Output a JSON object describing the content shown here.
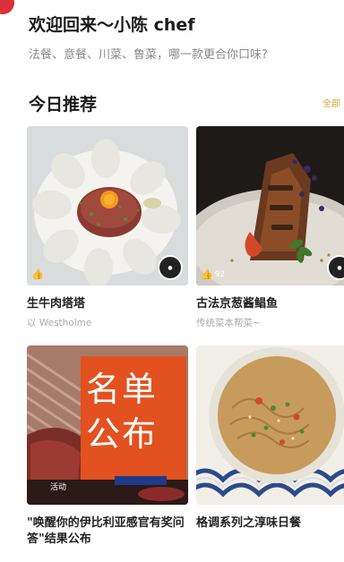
{
  "header": {
    "greeting": "欢迎回来～小陈 chef",
    "subtitle": "法餐、意餐、川菜、鲁菜，哪一款更合你口味?"
  },
  "section": {
    "title": "今日推荐",
    "more_label": "全部"
  },
  "cards": [
    {
      "title": "生牛肉塔塔",
      "meta": "以 Westholme",
      "likes": "",
      "image_icon": "beef-tartare-image"
    },
    {
      "title": "古法京葱酱鲳鱼",
      "meta": "传统菜本帮菜~",
      "likes": "92",
      "image_icon": "braised-fish-image"
    },
    {
      "title": "\"唤醒你的伊比利亚感官有奖问答\"结果公布",
      "meta": "",
      "image_text_1": "名单",
      "image_text_2": "公布",
      "overlay_tag": "活动",
      "image_icon": "iberico-ham-image"
    },
    {
      "title": "格调系列之淳味日餐",
      "meta": "",
      "likes": "",
      "image_icon": "japanese-noodle-image"
    }
  ],
  "colors": {
    "accent": "#e0a12b",
    "announce": "#e2511f",
    "badge": "#d9303a"
  }
}
